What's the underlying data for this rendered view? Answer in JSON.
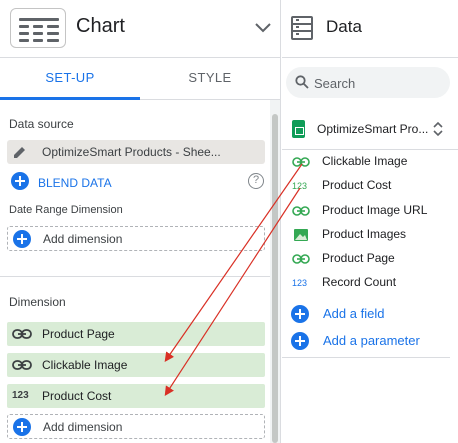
{
  "left_panel": {
    "chart_type_label": "Chart",
    "tabs": [
      {
        "label": "SET-UP",
        "active": true
      },
      {
        "label": "STYLE",
        "active": false
      }
    ],
    "data_source": {
      "section_label": "Data source",
      "name": "OptimizeSmart Products - Shee...",
      "blend_label": "BLEND DATA"
    },
    "date_range": {
      "section_label": "Date Range Dimension",
      "add_label": "Add dimension"
    },
    "dimension": {
      "section_label": "Dimension",
      "items": [
        {
          "icon": "link-icon",
          "label": "Product Page"
        },
        {
          "icon": "link-icon",
          "label": "Clickable Image"
        },
        {
          "icon": "number-icon",
          "icon_text": "123",
          "label": "Product Cost"
        }
      ],
      "add_label": "Add dimension"
    }
  },
  "right_panel": {
    "title": "Data",
    "search": {
      "placeholder": "Search"
    },
    "source_name": "OptimizeSmart Pro...",
    "fields": [
      {
        "icon": "link-icon",
        "label": "Clickable Image"
      },
      {
        "icon": "number-icon",
        "icon_text": "123",
        "label": "Product Cost"
      },
      {
        "icon": "link-icon",
        "label": "Product Image URL"
      },
      {
        "icon": "image-icon",
        "label": "Product Images"
      },
      {
        "icon": "link-icon",
        "label": "Product Page"
      },
      {
        "icon": "number-icon",
        "icon_text": "123",
        "label": "Record Count"
      }
    ],
    "add_field_label": "Add a field",
    "add_parameter_label": "Add a parameter"
  },
  "colors": {
    "accent": "#1a73e8",
    "dimension_chip": "#d9ecd6",
    "arrow": "#d93025",
    "sheets_green": "#0f9d58"
  }
}
